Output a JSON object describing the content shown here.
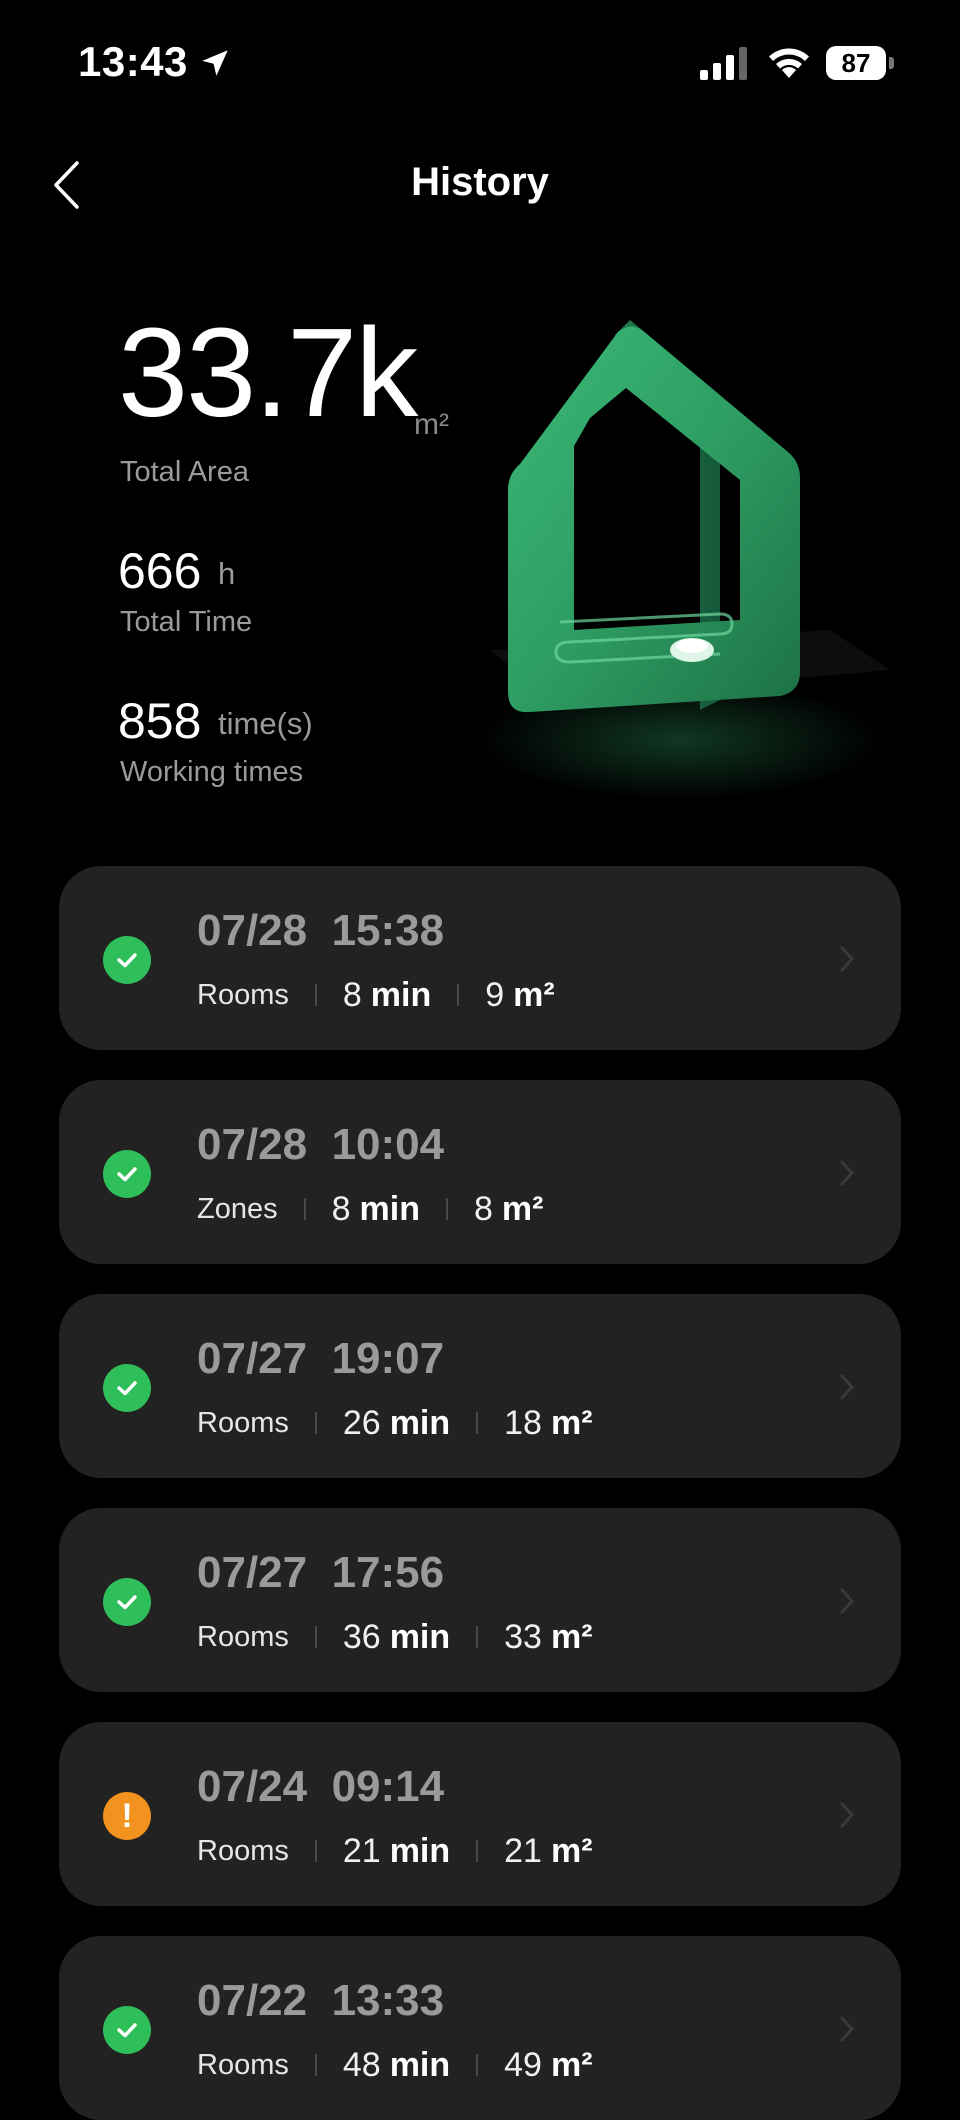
{
  "status_bar": {
    "time": "13:43",
    "battery": "87"
  },
  "header": {
    "title": "History"
  },
  "stats": {
    "total_area_value": "33.7k",
    "total_area_unit": "m²",
    "total_area_label": "Total Area",
    "total_time_value": "666",
    "total_time_unit": "h",
    "total_time_label": "Total Time",
    "working_times_value": "858",
    "working_times_unit": "time(s)",
    "working_times_label": "Working times"
  },
  "colors": {
    "background": "#000000",
    "card": "#222222",
    "success": "#2fbf5a",
    "warning": "#f3931f",
    "house_green": "#2e9e63"
  },
  "records": [
    {
      "date": "07/28",
      "time": "15:38",
      "mode": "Rooms",
      "duration": "8",
      "duration_unit": "min",
      "area": "9",
      "area_unit": "m²",
      "status": "success"
    },
    {
      "date": "07/28",
      "time": "10:04",
      "mode": "Zones",
      "duration": "8",
      "duration_unit": "min",
      "area": "8",
      "area_unit": "m²",
      "status": "success"
    },
    {
      "date": "07/27",
      "time": "19:07",
      "mode": "Rooms",
      "duration": "26",
      "duration_unit": "min",
      "area": "18",
      "area_unit": "m²",
      "status": "success"
    },
    {
      "date": "07/27",
      "time": "17:56",
      "mode": "Rooms",
      "duration": "36",
      "duration_unit": "min",
      "area": "33",
      "area_unit": "m²",
      "status": "success"
    },
    {
      "date": "07/24",
      "time": "09:14",
      "mode": "Rooms",
      "duration": "21",
      "duration_unit": "min",
      "area": "21",
      "area_unit": "m²",
      "status": "warning"
    },
    {
      "date": "07/22",
      "time": "13:33",
      "mode": "Rooms",
      "duration": "48",
      "duration_unit": "min",
      "area": "49",
      "area_unit": "m²",
      "status": "success"
    }
  ]
}
